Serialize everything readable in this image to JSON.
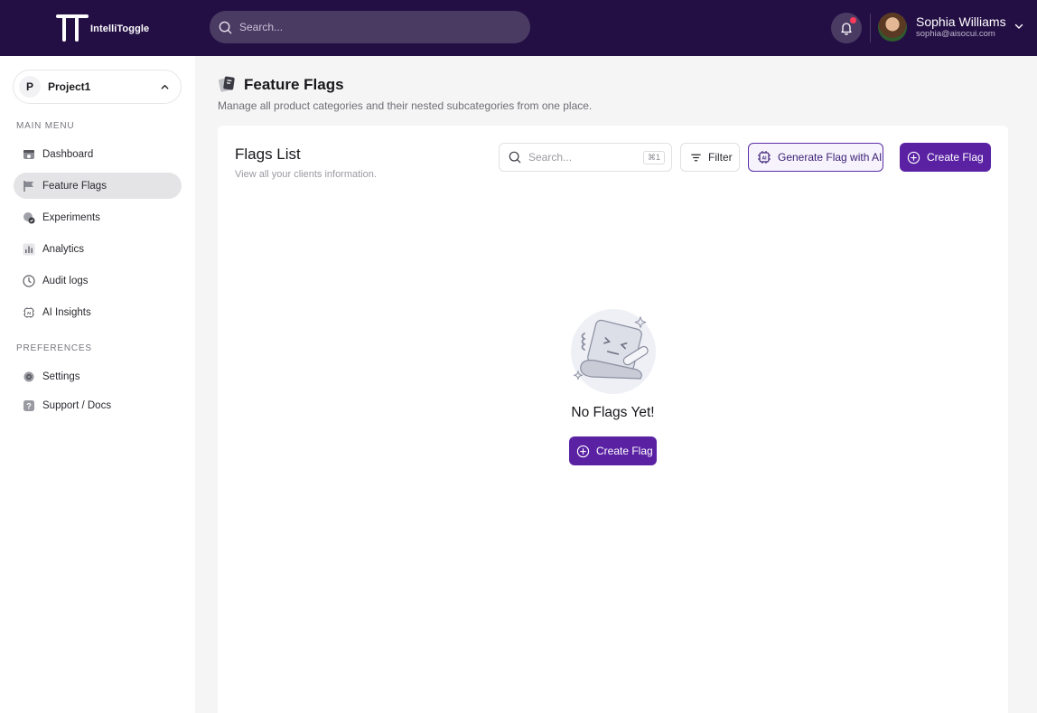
{
  "app": {
    "brand": "IntelliToggle",
    "search_placeholder": "Search..."
  },
  "user": {
    "name": "Sophia Williams",
    "email": "sophia@aisocui.com"
  },
  "project": {
    "badge": "P",
    "name": "Project1"
  },
  "sidebar": {
    "main_menu_label": "MAIN MENU",
    "preferences_label": "PREFERENCES",
    "items": [
      {
        "label": "Dashboard",
        "icon": "dashboard-icon"
      },
      {
        "label": "Feature Flags",
        "icon": "flag-icon"
      },
      {
        "label": "Experiments",
        "icon": "experiments-icon"
      },
      {
        "label": "Analytics",
        "icon": "analytics-icon"
      },
      {
        "label": "Audit logs",
        "icon": "clock-icon"
      },
      {
        "label": "AI Insights",
        "icon": "ai-chip-icon"
      }
    ],
    "pref_items": [
      {
        "label": "Settings",
        "icon": "gear-icon"
      },
      {
        "label": "Support / Docs",
        "icon": "help-icon"
      }
    ],
    "active": "Feature Flags"
  },
  "page": {
    "title": "Feature Flags",
    "subtitle": "Manage all product categories and their nested subcategories from one place."
  },
  "flags_card": {
    "title": "Flags List",
    "subtitle": "View all your clients information.",
    "search_placeholder": "Search...",
    "search_shortcut": "⌘1",
    "filter_label": "Filter",
    "generate_label": "Generate Flag with AI",
    "create_label": "Create Flag"
  },
  "empty_state": {
    "title": "No Flags Yet!",
    "button_label": "Create Flag"
  },
  "colors": {
    "topbar": "#240f45",
    "accent": "#5a22a3",
    "notification_dot": "#ff3b5b"
  }
}
